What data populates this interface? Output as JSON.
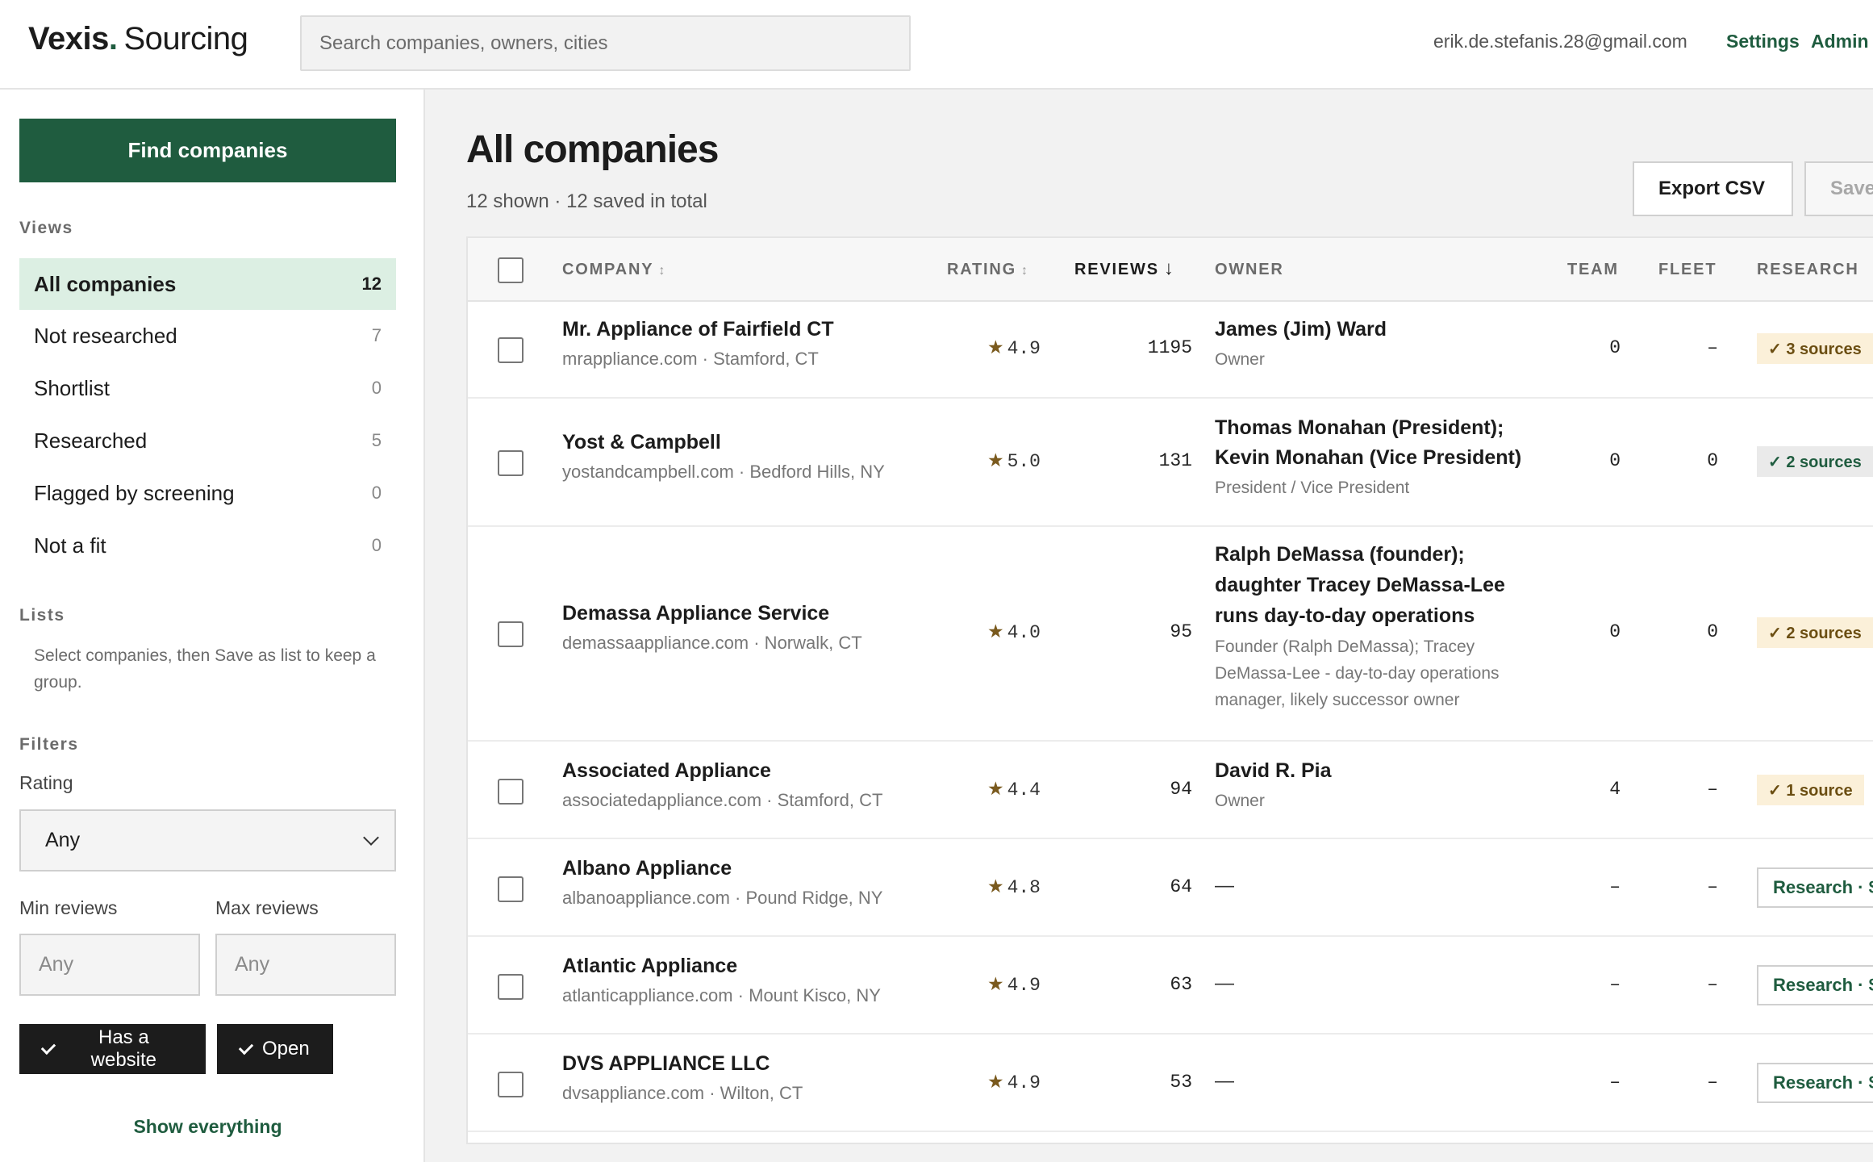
{
  "header": {
    "brand_mark": "Vexis",
    "brand_dot": ".",
    "brand_sub": "Sourcing",
    "search_placeholder": "Search companies, owners, cities",
    "user_email": "erik.de.stefanis.28@gmail.com",
    "settings_label": "Settings",
    "admin_label": "Admin"
  },
  "sidebar": {
    "find_button": "Find companies",
    "views_label": "Views",
    "views": [
      {
        "label": "All companies",
        "count": "12",
        "active": true
      },
      {
        "label": "Not researched",
        "count": "7"
      },
      {
        "label": "Shortlist",
        "count": "0"
      },
      {
        "label": "Researched",
        "count": "5"
      },
      {
        "label": "Flagged by screening",
        "count": "0"
      },
      {
        "label": "Not a fit",
        "count": "0"
      }
    ],
    "lists_label": "Lists",
    "lists_help": "Select companies, then Save as list to keep a group.",
    "filters_label": "Filters",
    "rating_label": "Rating",
    "rating_value": "Any",
    "min_reviews_label": "Min reviews",
    "max_reviews_label": "Max reviews",
    "min_reviews_placeholder": "Any",
    "max_reviews_placeholder": "Any",
    "toggle_website": "Has a website",
    "toggle_open": "Open",
    "show_everything": "Show everything"
  },
  "main": {
    "title": "All companies",
    "subtitle": "12 shown · 12 saved in total",
    "export_label": "Export CSV",
    "save_label": "Save"
  },
  "table": {
    "columns": {
      "company": "COMPANY",
      "rating": "RATING",
      "reviews": "REVIEWS",
      "owner": "OWNER",
      "team": "TEAM",
      "fleet": "FLEET",
      "research": "RESEARCH"
    },
    "sort_arrows": "↕",
    "sort_down": "↓",
    "star": "★",
    "rows": [
      {
        "name": "Mr. Appliance of Fairfield CT",
        "meta": "mrappliance.com · Stamford, CT",
        "rating": "4.9",
        "reviews": "1195",
        "owner_line1": "James (Jim) Ward",
        "owner_role_line1": "Owner",
        "team": "0",
        "fleet": "–",
        "research": "✓ 3 sources",
        "research_style": "warm"
      },
      {
        "name": "Yost & Campbell",
        "meta": "yostandcampbell.com · Bedford Hills, NY",
        "rating": "5.0",
        "reviews": "131",
        "owner_line1": "Thomas Monahan (President);",
        "owner_line2": "Kevin Monahan (Vice President)",
        "owner_role_line1": "President / Vice President",
        "team": "0",
        "fleet": "0",
        "research": "✓ 2 sources",
        "research_style": "cool"
      },
      {
        "name": "Demassa Appliance Service",
        "meta": "demassaappliance.com · Norwalk, CT",
        "rating": "4.0",
        "reviews": "95",
        "owner_line1": "Ralph DeMassa (founder);",
        "owner_line2": "daughter Tracey DeMassa-Lee",
        "owner_line3": "runs day-to-day operations",
        "owner_role_line1": "Founder (Ralph DeMassa); Tracey",
        "owner_role_line2": "DeMassa-Lee - day-to-day operations",
        "owner_role_line3": "manager, likely successor owner",
        "team": "0",
        "fleet": "0",
        "research": "✓ 2 sources",
        "research_style": "warm"
      },
      {
        "name": "Associated Appliance",
        "meta": "associatedappliance.com · Stamford, CT",
        "rating": "4.4",
        "reviews": "94",
        "owner_line1": "David R. Pia",
        "owner_role_line1": "Owner",
        "team": "4",
        "fleet": "–",
        "research": "✓ 1 source",
        "research_style": "warm"
      },
      {
        "name": "Albano Appliance",
        "meta": "albanoappliance.com · Pound Ridge, NY",
        "rating": "4.8",
        "reviews": "64",
        "owner_line1": "—",
        "team": "–",
        "fleet": "–",
        "research": "Research · $"
      },
      {
        "name": "Atlantic Appliance",
        "meta": "atlanticappliance.com · Mount Kisco, NY",
        "rating": "4.9",
        "reviews": "63",
        "owner_line1": "—",
        "team": "–",
        "fleet": "–",
        "research": "Research · $"
      },
      {
        "name": "DVS APPLIANCE LLC",
        "meta": "dvsappliance.com · Wilton, CT",
        "rating": "4.9",
        "reviews": "53",
        "owner_line1": "—",
        "team": "–",
        "fleet": "–",
        "research": "Research · $"
      }
    ]
  }
}
